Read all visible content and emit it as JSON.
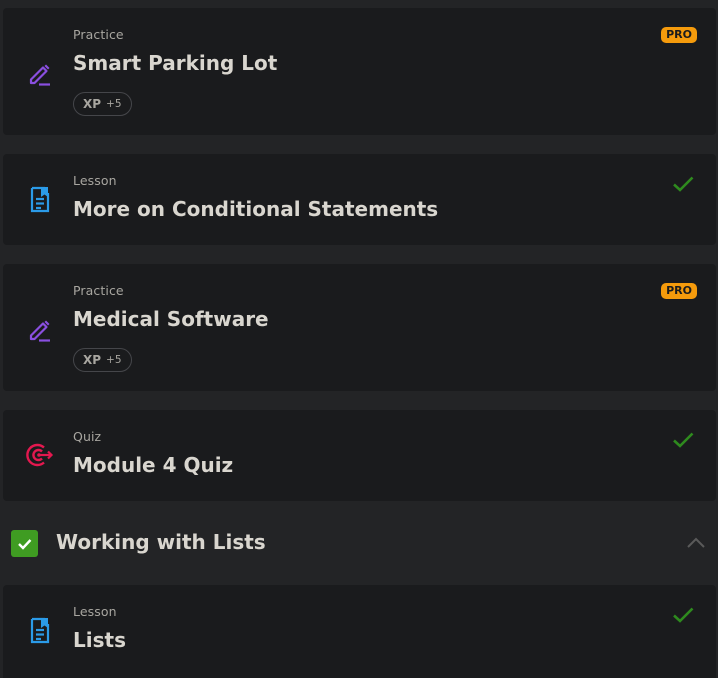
{
  "items": [
    {
      "kind": "Practice",
      "title": "Smart Parking Lot",
      "badge": "PRO",
      "xp_label": "XP",
      "xp_value": "+5",
      "icon": "pencil-icon"
    },
    {
      "kind": "Lesson",
      "title": "More on Conditional Statements",
      "status": "completed",
      "icon": "lesson-icon"
    },
    {
      "kind": "Practice",
      "title": "Medical Software",
      "badge": "PRO",
      "xp_label": "XP",
      "xp_value": "+5",
      "icon": "pencil-icon"
    },
    {
      "kind": "Quiz",
      "title": "Module 4 Quiz",
      "status": "completed",
      "icon": "target-icon"
    }
  ],
  "section": {
    "title": "Working with Lists",
    "status": "completed",
    "expanded": true
  },
  "section_items": [
    {
      "kind": "Lesson",
      "title": "Lists",
      "status": "completed",
      "icon": "lesson-icon"
    }
  ],
  "colors": {
    "background": "#232426",
    "card": "#1a1b1d",
    "pro_badge": "#f59b0c",
    "check": "#2e8a1e",
    "section_check": "#3f9c22",
    "pencil_icon": "#8a4fe0",
    "lesson_icon": "#2b9be8",
    "quiz_icon": "#e4184f"
  }
}
